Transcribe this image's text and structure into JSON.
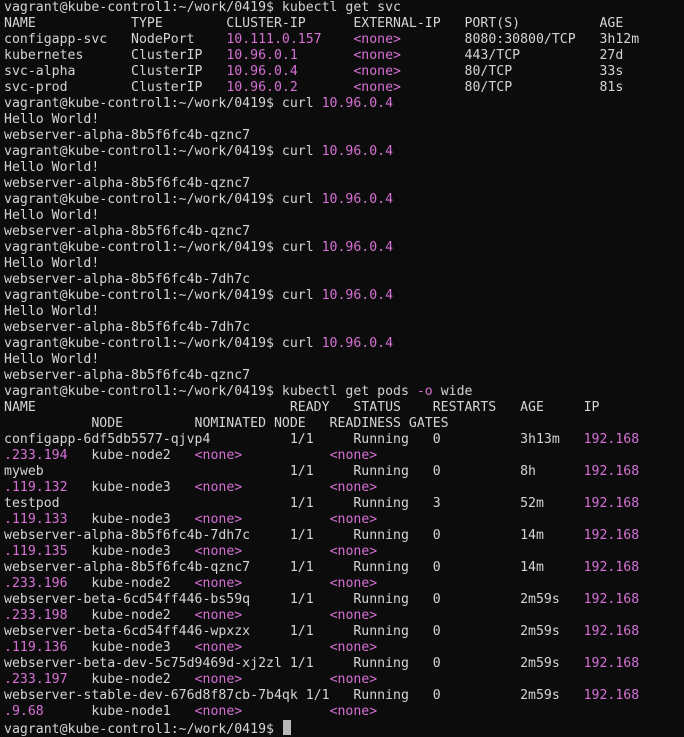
{
  "lines": [
    [
      {
        "t": "vagrant@kube-control1:~/work/0419$ kubectl get svc"
      }
    ],
    [
      {
        "t": "NAME            TYPE        CLUSTER-IP      EXTERNAL-IP   PORT(S)          AGE"
      }
    ],
    [
      {
        "t": "configapp-svc   NodePort    "
      },
      {
        "t": "10.111.0.157",
        "c": "mag"
      },
      {
        "t": "    "
      },
      {
        "t": "<none>",
        "c": "mag"
      },
      {
        "t": "        8080:30800/TCP   3h12m"
      }
    ],
    [
      {
        "t": "kubernetes      ClusterIP   "
      },
      {
        "t": "10.96.0.1",
        "c": "mag"
      },
      {
        "t": "       "
      },
      {
        "t": "<none>",
        "c": "mag"
      },
      {
        "t": "        443/TCP          27d"
      }
    ],
    [
      {
        "t": "svc-alpha       ClusterIP   "
      },
      {
        "t": "10.96.0.4",
        "c": "mag"
      },
      {
        "t": "       "
      },
      {
        "t": "<none>",
        "c": "mag"
      },
      {
        "t": "        80/TCP           33s"
      }
    ],
    [
      {
        "t": "svc-prod        ClusterIP   "
      },
      {
        "t": "10.96.0.2",
        "c": "mag"
      },
      {
        "t": "       "
      },
      {
        "t": "<none>",
        "c": "mag"
      },
      {
        "t": "        80/TCP           81s"
      }
    ],
    [
      {
        "t": "vagrant@kube-control1:~/work/0419$ curl "
      },
      {
        "t": "10.96.0.4",
        "c": "mag"
      }
    ],
    [
      {
        "t": "Hello World!"
      }
    ],
    [
      {
        "t": "webserver-alpha-8b5f6fc4b-qznc7"
      }
    ],
    [
      {
        "t": "vagrant@kube-control1:~/work/0419$ curl "
      },
      {
        "t": "10.96.0.4",
        "c": "mag"
      }
    ],
    [
      {
        "t": "Hello World!"
      }
    ],
    [
      {
        "t": "webserver-alpha-8b5f6fc4b-qznc7"
      }
    ],
    [
      {
        "t": "vagrant@kube-control1:~/work/0419$ curl "
      },
      {
        "t": "10.96.0.4",
        "c": "mag"
      }
    ],
    [
      {
        "t": "Hello World!"
      }
    ],
    [
      {
        "t": "webserver-alpha-8b5f6fc4b-qznc7"
      }
    ],
    [
      {
        "t": "vagrant@kube-control1:~/work/0419$ curl "
      },
      {
        "t": "10.96.0.4",
        "c": "mag"
      }
    ],
    [
      {
        "t": "Hello World!"
      }
    ],
    [
      {
        "t": "webserver-alpha-8b5f6fc4b-7dh7c"
      }
    ],
    [
      {
        "t": "vagrant@kube-control1:~/work/0419$ curl "
      },
      {
        "t": "10.96.0.4",
        "c": "mag"
      }
    ],
    [
      {
        "t": "Hello World!"
      }
    ],
    [
      {
        "t": "webserver-alpha-8b5f6fc4b-7dh7c"
      }
    ],
    [
      {
        "t": "vagrant@kube-control1:~/work/0419$ curl "
      },
      {
        "t": "10.96.0.4",
        "c": "mag"
      }
    ],
    [
      {
        "t": "Hello World!"
      }
    ],
    [
      {
        "t": "webserver-alpha-8b5f6fc4b-qznc7"
      }
    ],
    [
      {
        "t": "vagrant@kube-control1:~/work/0419$ kubectl get pods "
      },
      {
        "t": "-o",
        "c": "mag"
      },
      {
        "t": " wide"
      }
    ],
    [
      {
        "t": "NAME                                READY   STATUS    RESTARTS   AGE     IP"
      }
    ],
    [
      {
        "t": "           NODE         NOMINATED NODE   READINESS GATES"
      }
    ],
    [
      {
        "t": "configapp-6df5db5577-qjvp4          1/1     Running   0          3h13m   "
      },
      {
        "t": "192.168",
        "c": "mag"
      }
    ],
    [
      {
        "t": ".233.194",
        "c": "mag"
      },
      {
        "t": "   kube-node2   "
      },
      {
        "t": "<none>",
        "c": "mag"
      },
      {
        "t": "           "
      },
      {
        "t": "<none>",
        "c": "mag"
      }
    ],
    [
      {
        "t": "myweb                               1/1     Running   0          8h      "
      },
      {
        "t": "192.168",
        "c": "mag"
      }
    ],
    [
      {
        "t": ".119.132",
        "c": "mag"
      },
      {
        "t": "   kube-node3   "
      },
      {
        "t": "<none>",
        "c": "mag"
      },
      {
        "t": "           "
      },
      {
        "t": "<none>",
        "c": "mag"
      }
    ],
    [
      {
        "t": "testpod                             1/1     Running   3          52m     "
      },
      {
        "t": "192.168",
        "c": "mag"
      }
    ],
    [
      {
        "t": ".119.133",
        "c": "mag"
      },
      {
        "t": "   kube-node3   "
      },
      {
        "t": "<none>",
        "c": "mag"
      },
      {
        "t": "           "
      },
      {
        "t": "<none>",
        "c": "mag"
      }
    ],
    [
      {
        "t": "webserver-alpha-8b5f6fc4b-7dh7c     1/1     Running   0          14m     "
      },
      {
        "t": "192.168",
        "c": "mag"
      }
    ],
    [
      {
        "t": ".119.135",
        "c": "mag"
      },
      {
        "t": "   kube-node3   "
      },
      {
        "t": "<none>",
        "c": "mag"
      },
      {
        "t": "           "
      },
      {
        "t": "<none>",
        "c": "mag"
      }
    ],
    [
      {
        "t": "webserver-alpha-8b5f6fc4b-qznc7     1/1     Running   0          14m     "
      },
      {
        "t": "192.168",
        "c": "mag"
      }
    ],
    [
      {
        "t": ".233.196",
        "c": "mag"
      },
      {
        "t": "   kube-node2   "
      },
      {
        "t": "<none>",
        "c": "mag"
      },
      {
        "t": "           "
      },
      {
        "t": "<none>",
        "c": "mag"
      }
    ],
    [
      {
        "t": "webserver-beta-6cd54ff446-bs59q     1/1     Running   0          2m59s   "
      },
      {
        "t": "192.168",
        "c": "mag"
      }
    ],
    [
      {
        "t": ".233.198",
        "c": "mag"
      },
      {
        "t": "   kube-node2   "
      },
      {
        "t": "<none>",
        "c": "mag"
      },
      {
        "t": "           "
      },
      {
        "t": "<none>",
        "c": "mag"
      }
    ],
    [
      {
        "t": "webserver-beta-6cd54ff446-wpxzx     1/1     Running   0          2m59s   "
      },
      {
        "t": "192.168",
        "c": "mag"
      }
    ],
    [
      {
        "t": ".119.136",
        "c": "mag"
      },
      {
        "t": "   kube-node3   "
      },
      {
        "t": "<none>",
        "c": "mag"
      },
      {
        "t": "           "
      },
      {
        "t": "<none>",
        "c": "mag"
      }
    ],
    [
      {
        "t": "webserver-beta-dev-5c75d9469d-xj2zl 1/1     Running   0          2m59s   "
      },
      {
        "t": "192.168",
        "c": "mag"
      }
    ],
    [
      {
        "t": ".233.197",
        "c": "mag"
      },
      {
        "t": "   kube-node2   "
      },
      {
        "t": "<none>",
        "c": "mag"
      },
      {
        "t": "           "
      },
      {
        "t": "<none>",
        "c": "mag"
      }
    ],
    [
      {
        "t": "webserver-stable-dev-676d8f87cb-7b4qk 1/1   Running   0          2m59s   "
      },
      {
        "t": "192.168",
        "c": "mag"
      }
    ],
    [
      {
        "t": ".9.68",
        "c": "mag"
      },
      {
        "t": "      kube-node1   "
      },
      {
        "t": "<none>",
        "c": "mag"
      },
      {
        "t": "           "
      },
      {
        "t": "<none>",
        "c": "mag"
      }
    ],
    [
      {
        "t": "vagrant@kube-control1:~/work/0419$ "
      }
    ]
  ],
  "colors": {
    "background": "#0c0c0c",
    "text": "#d4d4d4",
    "accent_magenta": "#d670d6",
    "cursor": "#b8b8b8"
  }
}
